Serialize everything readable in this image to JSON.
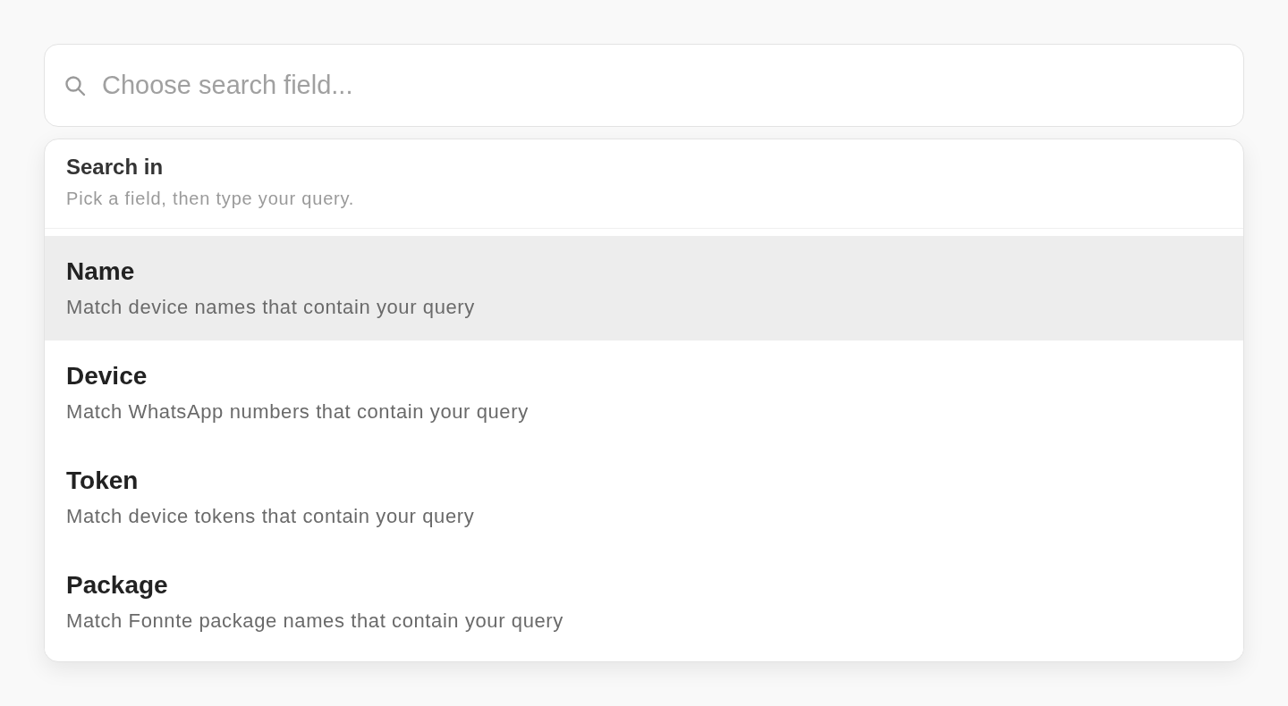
{
  "search": {
    "placeholder": "Choose search field..."
  },
  "dropdown": {
    "title": "Search in",
    "subtitle": "Pick a field, then type your query.",
    "options": [
      {
        "label": "Name",
        "description": "Match device names that contain your query",
        "selected": true
      },
      {
        "label": "Device",
        "description": "Match WhatsApp numbers that contain your query",
        "selected": false
      },
      {
        "label": "Token",
        "description": "Match device tokens that contain your query",
        "selected": false
      },
      {
        "label": "Package",
        "description": "Match Fonnte package names that contain your query",
        "selected": false
      }
    ]
  }
}
